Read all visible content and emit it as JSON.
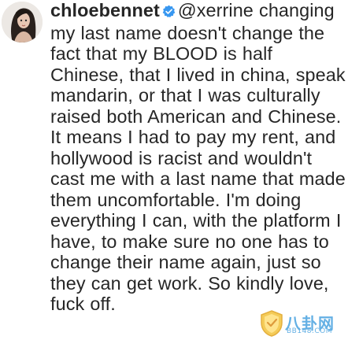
{
  "comment": {
    "username": "chloebennet",
    "mention": "@xerrine",
    "text": "changing my last name doesn't change the fact that my BLOOD is half Chinese, that I lived in china, speak mandarin, or that I was culturally raised both American and Chinese. It means I had to pay my rent, and hollywood is racist and wouldn't cast me with a last name that made them uncomfortable. I'm doing everything I can, with the platform I have, to make sure no one has to change their name again, just so they can get work. So kindly love, fuck off."
  },
  "watermark": {
    "brand": "八卦网",
    "site": "BB148.COM"
  },
  "colors": {
    "text": "#262626",
    "verified_badge": "#3897f0",
    "watermark": "#4aa3e0"
  }
}
